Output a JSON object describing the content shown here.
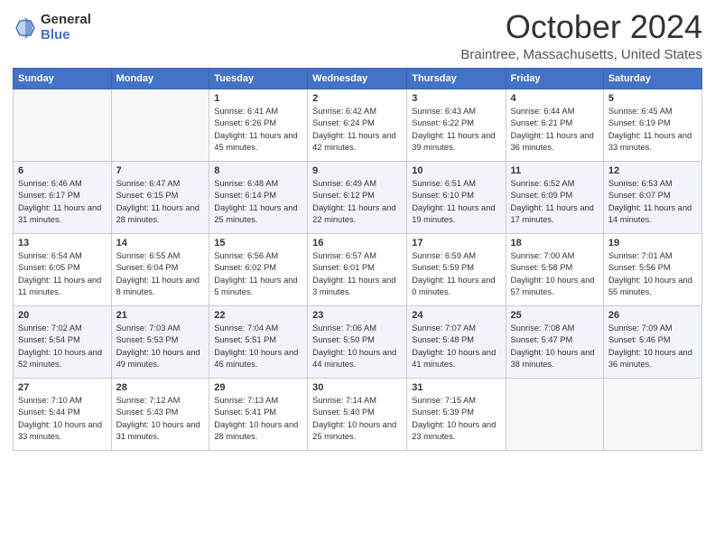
{
  "logo": {
    "text_top": "General",
    "text_bottom": "Blue"
  },
  "header": {
    "month": "October 2024",
    "location": "Braintree, Massachusetts, United States"
  },
  "days_of_week": [
    "Sunday",
    "Monday",
    "Tuesday",
    "Wednesday",
    "Thursday",
    "Friday",
    "Saturday"
  ],
  "weeks": [
    [
      {
        "day": "",
        "info": ""
      },
      {
        "day": "",
        "info": ""
      },
      {
        "day": "1",
        "info": "Sunrise: 6:41 AM\nSunset: 6:26 PM\nDaylight: 11 hours and 45 minutes."
      },
      {
        "day": "2",
        "info": "Sunrise: 6:42 AM\nSunset: 6:24 PM\nDaylight: 11 hours and 42 minutes."
      },
      {
        "day": "3",
        "info": "Sunrise: 6:43 AM\nSunset: 6:22 PM\nDaylight: 11 hours and 39 minutes."
      },
      {
        "day": "4",
        "info": "Sunrise: 6:44 AM\nSunset: 6:21 PM\nDaylight: 11 hours and 36 minutes."
      },
      {
        "day": "5",
        "info": "Sunrise: 6:45 AM\nSunset: 6:19 PM\nDaylight: 11 hours and 33 minutes."
      }
    ],
    [
      {
        "day": "6",
        "info": "Sunrise: 6:46 AM\nSunset: 6:17 PM\nDaylight: 11 hours and 31 minutes."
      },
      {
        "day": "7",
        "info": "Sunrise: 6:47 AM\nSunset: 6:15 PM\nDaylight: 11 hours and 28 minutes."
      },
      {
        "day": "8",
        "info": "Sunrise: 6:48 AM\nSunset: 6:14 PM\nDaylight: 11 hours and 25 minutes."
      },
      {
        "day": "9",
        "info": "Sunrise: 6:49 AM\nSunset: 6:12 PM\nDaylight: 11 hours and 22 minutes."
      },
      {
        "day": "10",
        "info": "Sunrise: 6:51 AM\nSunset: 6:10 PM\nDaylight: 11 hours and 19 minutes."
      },
      {
        "day": "11",
        "info": "Sunrise: 6:52 AM\nSunset: 6:09 PM\nDaylight: 11 hours and 17 minutes."
      },
      {
        "day": "12",
        "info": "Sunrise: 6:53 AM\nSunset: 6:07 PM\nDaylight: 11 hours and 14 minutes."
      }
    ],
    [
      {
        "day": "13",
        "info": "Sunrise: 6:54 AM\nSunset: 6:05 PM\nDaylight: 11 hours and 11 minutes."
      },
      {
        "day": "14",
        "info": "Sunrise: 6:55 AM\nSunset: 6:04 PM\nDaylight: 11 hours and 8 minutes."
      },
      {
        "day": "15",
        "info": "Sunrise: 6:56 AM\nSunset: 6:02 PM\nDaylight: 11 hours and 5 minutes."
      },
      {
        "day": "16",
        "info": "Sunrise: 6:57 AM\nSunset: 6:01 PM\nDaylight: 11 hours and 3 minutes."
      },
      {
        "day": "17",
        "info": "Sunrise: 6:59 AM\nSunset: 5:59 PM\nDaylight: 11 hours and 0 minutes."
      },
      {
        "day": "18",
        "info": "Sunrise: 7:00 AM\nSunset: 5:58 PM\nDaylight: 10 hours and 57 minutes."
      },
      {
        "day": "19",
        "info": "Sunrise: 7:01 AM\nSunset: 5:56 PM\nDaylight: 10 hours and 55 minutes."
      }
    ],
    [
      {
        "day": "20",
        "info": "Sunrise: 7:02 AM\nSunset: 5:54 PM\nDaylight: 10 hours and 52 minutes."
      },
      {
        "day": "21",
        "info": "Sunrise: 7:03 AM\nSunset: 5:53 PM\nDaylight: 10 hours and 49 minutes."
      },
      {
        "day": "22",
        "info": "Sunrise: 7:04 AM\nSunset: 5:51 PM\nDaylight: 10 hours and 46 minutes."
      },
      {
        "day": "23",
        "info": "Sunrise: 7:06 AM\nSunset: 5:50 PM\nDaylight: 10 hours and 44 minutes."
      },
      {
        "day": "24",
        "info": "Sunrise: 7:07 AM\nSunset: 5:48 PM\nDaylight: 10 hours and 41 minutes."
      },
      {
        "day": "25",
        "info": "Sunrise: 7:08 AM\nSunset: 5:47 PM\nDaylight: 10 hours and 38 minutes."
      },
      {
        "day": "26",
        "info": "Sunrise: 7:09 AM\nSunset: 5:46 PM\nDaylight: 10 hours and 36 minutes."
      }
    ],
    [
      {
        "day": "27",
        "info": "Sunrise: 7:10 AM\nSunset: 5:44 PM\nDaylight: 10 hours and 33 minutes."
      },
      {
        "day": "28",
        "info": "Sunrise: 7:12 AM\nSunset: 5:43 PM\nDaylight: 10 hours and 31 minutes."
      },
      {
        "day": "29",
        "info": "Sunrise: 7:13 AM\nSunset: 5:41 PM\nDaylight: 10 hours and 28 minutes."
      },
      {
        "day": "30",
        "info": "Sunrise: 7:14 AM\nSunset: 5:40 PM\nDaylight: 10 hours and 25 minutes."
      },
      {
        "day": "31",
        "info": "Sunrise: 7:15 AM\nSunset: 5:39 PM\nDaylight: 10 hours and 23 minutes."
      },
      {
        "day": "",
        "info": ""
      },
      {
        "day": "",
        "info": ""
      }
    ]
  ]
}
